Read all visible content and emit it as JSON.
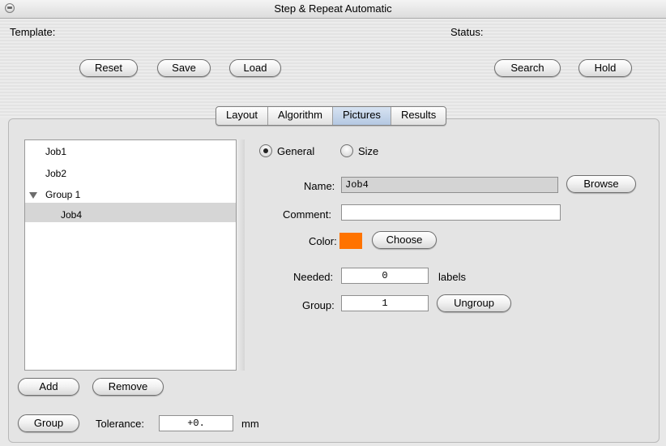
{
  "window": {
    "title": "Step & Repeat Automatic"
  },
  "header": {
    "template_label": "Template:",
    "status_label": "Status:",
    "buttons": {
      "reset": "Reset",
      "save": "Save",
      "load": "Load",
      "search": "Search",
      "hold": "Hold"
    }
  },
  "tabs": [
    {
      "label": "Layout",
      "active": false
    },
    {
      "label": "Algorithm",
      "active": false
    },
    {
      "label": "Pictures",
      "active": true
    },
    {
      "label": "Results",
      "active": false
    }
  ],
  "tree": {
    "items": [
      {
        "label": "Job1"
      },
      {
        "label": "Job2"
      },
      {
        "label": "Group 1",
        "expanded": true
      },
      {
        "label": "Job4",
        "selected": true
      }
    ]
  },
  "left_buttons": {
    "add": "Add",
    "remove": "Remove",
    "group": "Group"
  },
  "tolerance": {
    "label": "Tolerance:",
    "value": "+0.",
    "unit": "mm"
  },
  "mode": {
    "general": "General",
    "size": "Size",
    "selected": "General"
  },
  "form": {
    "name_label": "Name:",
    "name_value": "Job4",
    "browse": "Browse",
    "comment_label": "Comment:",
    "comment_value": "",
    "color_label": "Color:",
    "color_value": "#ff7300",
    "choose": "Choose",
    "needed_label": "Needed:",
    "needed_value": "0",
    "needed_unit": "labels",
    "group_label": "Group:",
    "group_value": "1",
    "ungroup": "Ungroup"
  }
}
